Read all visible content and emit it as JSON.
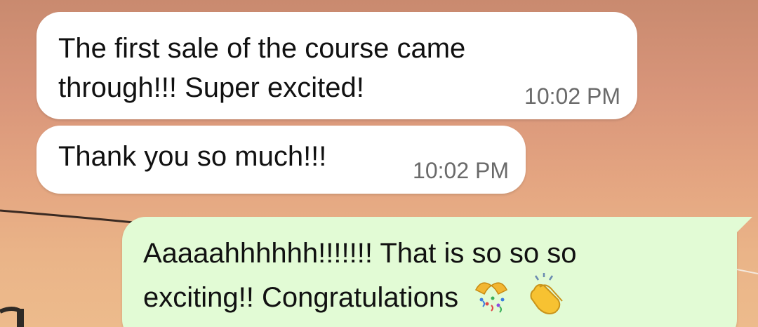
{
  "messages": [
    {
      "direction": "incoming",
      "text": "The first sale of the course came\nthrough!!! Super excited!",
      "time": "10:02 PM"
    },
    {
      "direction": "incoming",
      "text": "Thank you so much!!!",
      "time": "10:02 PM"
    },
    {
      "direction": "outgoing",
      "text": "Aaaaahhhhhh!!!!!!! That is so so so\nexciting!! Congratulations",
      "emojis": [
        "confetti-ball-icon",
        "clapping-hands-icon"
      ]
    }
  ],
  "colors": {
    "incoming_bubble": "#ffffff",
    "outgoing_bubble": "#e2fbd5",
    "timestamp": "#6a6a6a"
  }
}
